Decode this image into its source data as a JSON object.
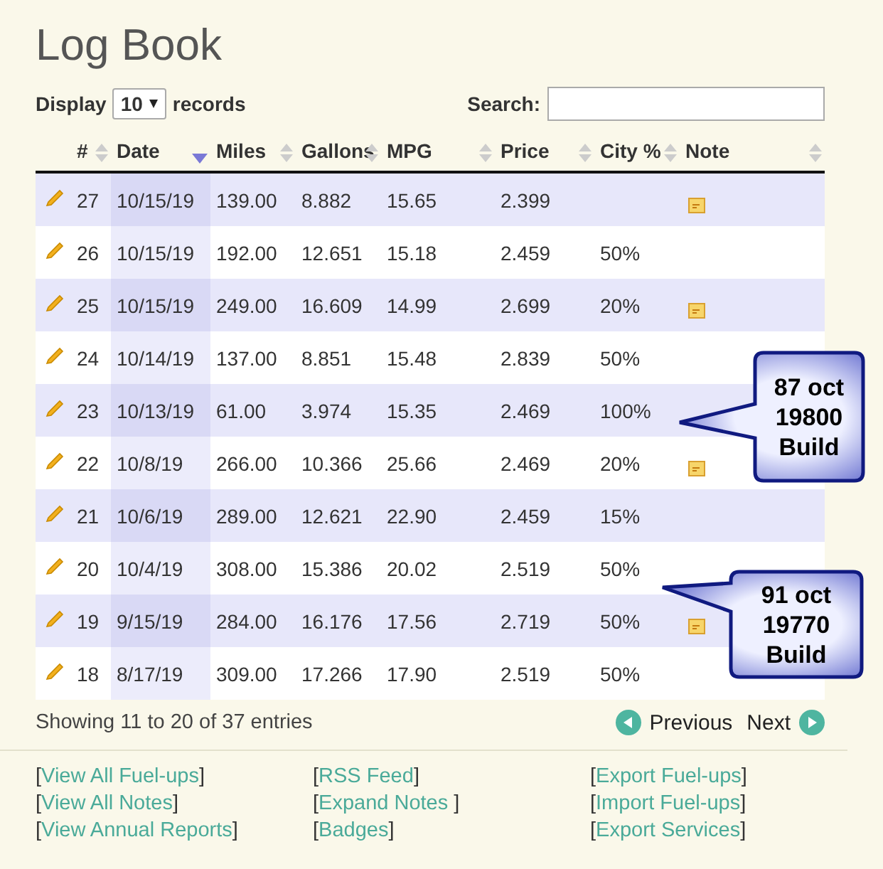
{
  "title": "Log Book",
  "display": {
    "label": "Display",
    "value": "10",
    "suffix": "records"
  },
  "search": {
    "label": "Search:"
  },
  "table": {
    "columns": [
      {
        "label": "#",
        "sorted": false
      },
      {
        "label": "Date",
        "sorted": true
      },
      {
        "label": "Miles",
        "sorted": false
      },
      {
        "label": "Gallons",
        "sorted": false
      },
      {
        "label": "MPG",
        "sorted": false
      },
      {
        "label": "Price",
        "sorted": false
      },
      {
        "label": "City %",
        "sorted": false
      },
      {
        "label": "Note",
        "sorted": false
      }
    ],
    "rows": [
      {
        "num": "27",
        "date": "10/15/19",
        "miles": "139.00",
        "gallons": "8.882",
        "mpg": "15.65",
        "price": "2.399",
        "city": "",
        "has_note": true
      },
      {
        "num": "26",
        "date": "10/15/19",
        "miles": "192.00",
        "gallons": "12.651",
        "mpg": "15.18",
        "price": "2.459",
        "city": "50%",
        "has_note": false
      },
      {
        "num": "25",
        "date": "10/15/19",
        "miles": "249.00",
        "gallons": "16.609",
        "mpg": "14.99",
        "price": "2.699",
        "city": "20%",
        "has_note": true
      },
      {
        "num": "24",
        "date": "10/14/19",
        "miles": "137.00",
        "gallons": "8.851",
        "mpg": "15.48",
        "price": "2.839",
        "city": "50%",
        "has_note": false
      },
      {
        "num": "23",
        "date": "10/13/19",
        "miles": "61.00",
        "gallons": "3.974",
        "mpg": "15.35",
        "price": "2.469",
        "city": "100%",
        "has_note": false
      },
      {
        "num": "22",
        "date": "10/8/19",
        "miles": "266.00",
        "gallons": "10.366",
        "mpg": "25.66",
        "price": "2.469",
        "city": "20%",
        "has_note": true
      },
      {
        "num": "21",
        "date": "10/6/19",
        "miles": "289.00",
        "gallons": "12.621",
        "mpg": "22.90",
        "price": "2.459",
        "city": "15%",
        "has_note": false
      },
      {
        "num": "20",
        "date": "10/4/19",
        "miles": "308.00",
        "gallons": "15.386",
        "mpg": "20.02",
        "price": "2.519",
        "city": "50%",
        "has_note": false
      },
      {
        "num": "19",
        "date": "9/15/19",
        "miles": "284.00",
        "gallons": "16.176",
        "mpg": "17.56",
        "price": "2.719",
        "city": "50%",
        "has_note": true
      },
      {
        "num": "18",
        "date": "8/17/19",
        "miles": "309.00",
        "gallons": "17.266",
        "mpg": "17.90",
        "price": "2.519",
        "city": "50%",
        "has_note": false
      }
    ]
  },
  "info": "Showing 11 to 20 of 37 entries",
  "pagination": {
    "previous": "Previous",
    "next": "Next"
  },
  "brackets": [
    "[",
    "]"
  ],
  "link_columns": [
    [
      "View All Fuel-ups",
      "View All Notes",
      "View Annual Reports"
    ],
    [
      "RSS Feed",
      "Expand Notes ",
      "Badges"
    ],
    [
      "Export Fuel-ups",
      "Import Fuel-ups",
      "Export Services"
    ]
  ],
  "callouts": [
    {
      "text": "87 oct\n19800\nBuild"
    },
    {
      "text": "91 oct\n19770\nBuild"
    }
  ]
}
